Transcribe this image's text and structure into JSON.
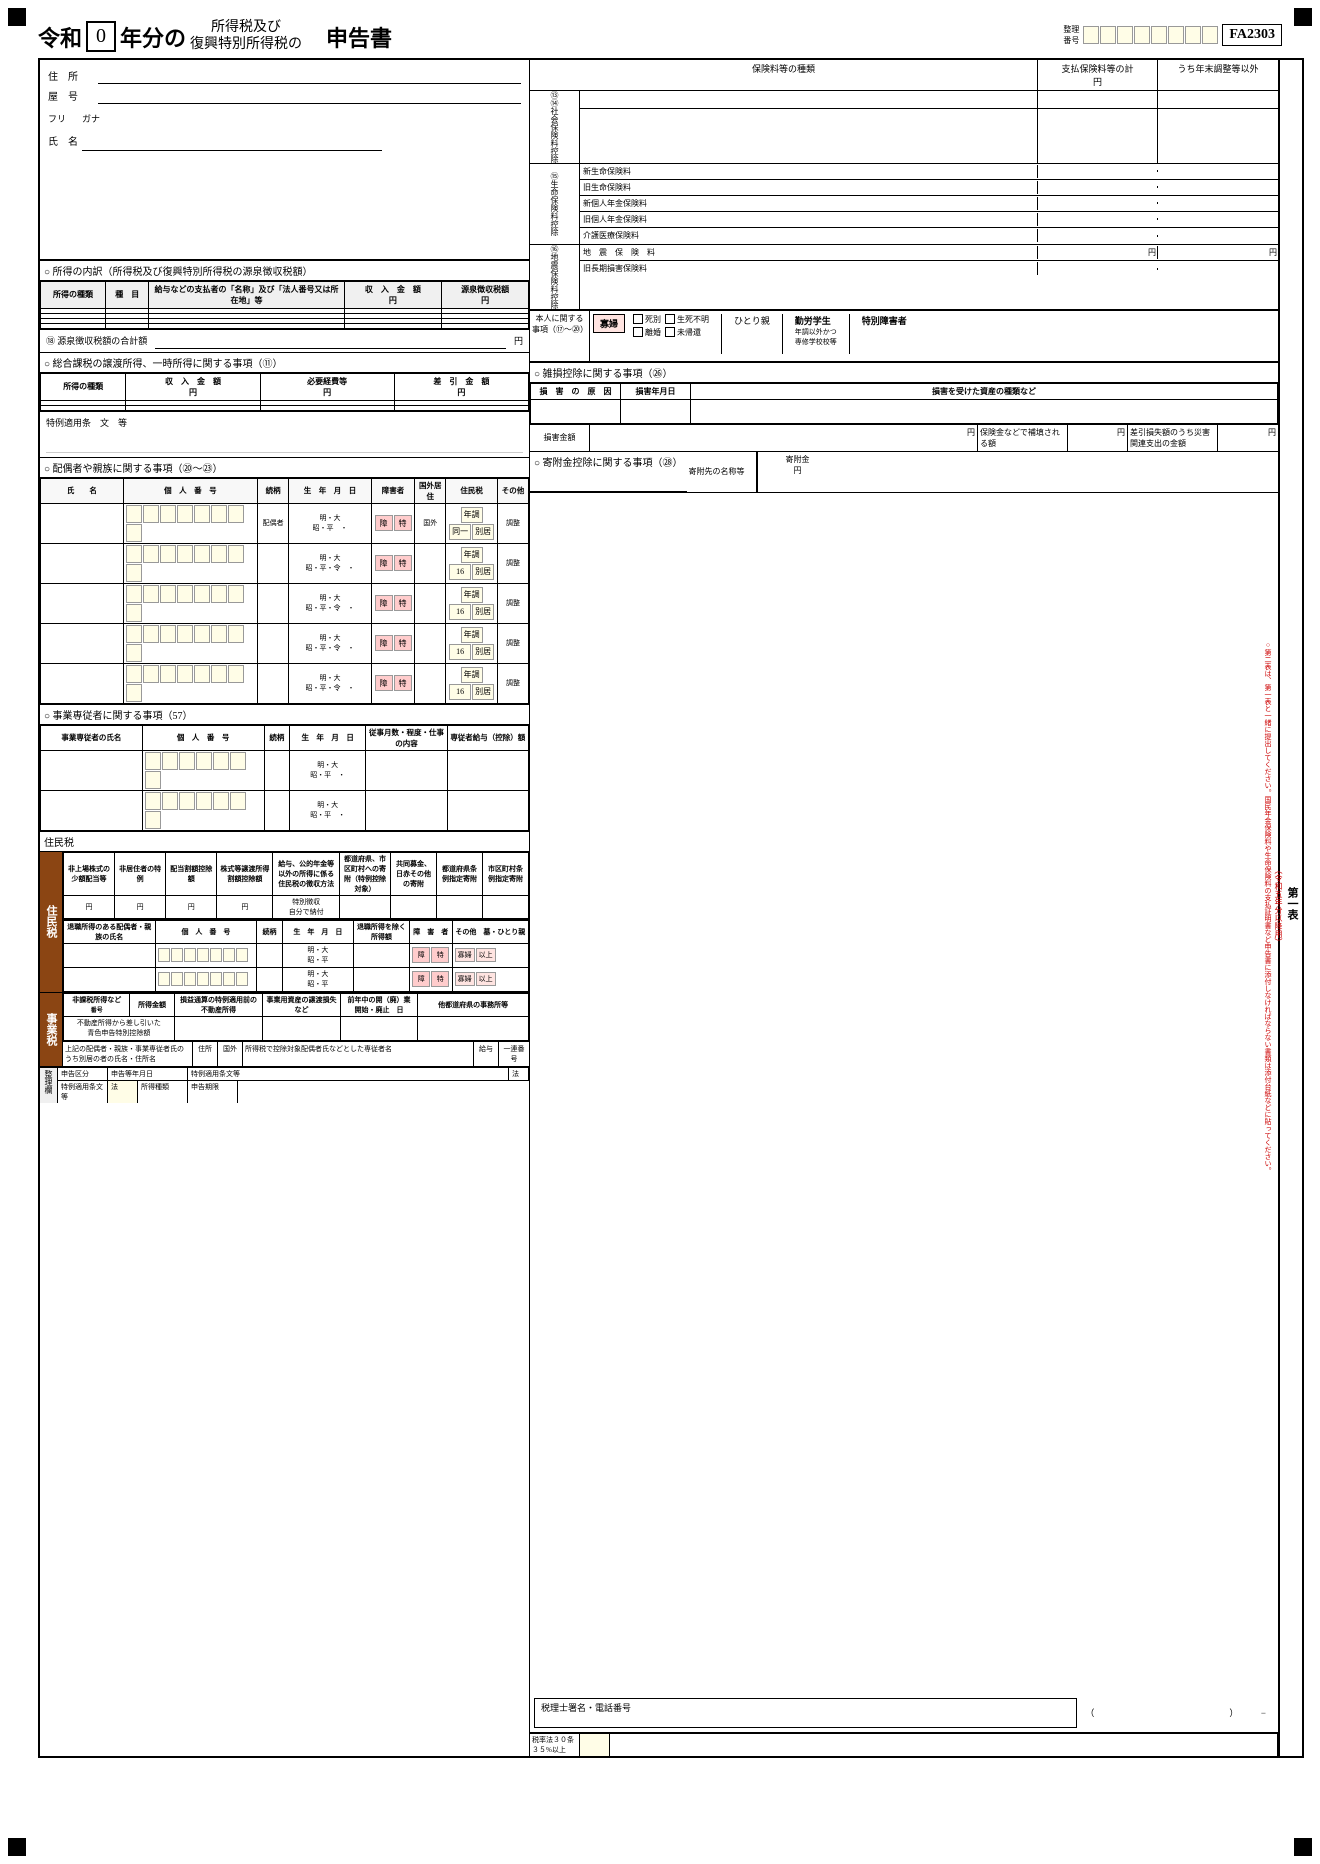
{
  "form": {
    "id": "FA2303",
    "reiwa_year": "0",
    "title_pre": "令和",
    "title_mid": "年分の",
    "title_sub1": "所得税及び",
    "title_sub2": "復興特別所得税の",
    "title_post": "申告書",
    "seiri_label": "整理番号",
    "dai_ichi_hyo": "第一表",
    "side_label_main": "第一表（令和五年分以降用）",
    "side_label_sub": "第二表は、第一表と一緒に提出してください。国民年金保険料や生命保険料の支払証明書など申告書に添付しなければならない書類は添付台紙などに貼ってください。"
  },
  "address": {
    "jyusho_label": "住　所",
    "heya_label": "屋　号",
    "furi_label": "フリ",
    "gana_label": "ガナ",
    "shimei_label": "氏　名"
  },
  "income_section": {
    "title": "○ 所得の内訳（所得税及び復興特別所得税の源泉徴収税額）",
    "col1": "所得の種類",
    "col2": "種　目",
    "col3": "給与などの支払者の「名称」及び「法人番号又は所在地」等",
    "col4": "収　入　金　額",
    "col5": "源泉徴収税額",
    "col4_unit": "円",
    "col5_unit": "円",
    "source_tax_label": "⑱ 源泉徴収税額の合計額",
    "source_tax_unit": "円"
  },
  "transfer_section": {
    "title": "○ 総合課税の譲渡所得、一時所得に関する事項（⑪）",
    "col1": "所得の種類",
    "col2": "収　入　金　額",
    "col3": "必要経費等",
    "col4": "差　引　金　額",
    "col2_unit": "円",
    "col3_unit": "円",
    "col4_unit": "円"
  },
  "special_clause": {
    "label": "特例適用条　文　等"
  },
  "insurance_section": {
    "col1": "保険料等の種類",
    "col2": "支払保険料等の計",
    "col3": "うち年末調整等以外",
    "col2_unit": "円",
    "col3_unit": "円",
    "row1314_label": "⑬⑭社会保険料控除",
    "row15_label": "⑮生命保険料控除",
    "ins_items": [
      {
        "name": "新生命保険料",
        "amount": "",
        "extra": ""
      },
      {
        "name": "旧生命保険料",
        "amount": "",
        "extra": ""
      },
      {
        "name": "新個人年金保険料",
        "amount": "",
        "extra": ""
      },
      {
        "name": "旧個人年金保険料",
        "amount": "",
        "extra": ""
      },
      {
        "name": "介護医療保険料",
        "amount": "",
        "extra": ""
      }
    ],
    "row16_label": "⑯地震保険料控除",
    "jishin_items": [
      {
        "name": "地　震　保　険　料",
        "amount": "",
        "extra": ""
      },
      {
        "name": "旧長期損害保険料",
        "amount": "",
        "extra": ""
      }
    ]
  },
  "personal_section": {
    "title": "本人に関する事項（⑰～⑳）",
    "haisai_label": "寡婦",
    "hitorishin_label": "ひとり親",
    "kinrosei_label": "勤労学生",
    "tokkyo_label": "特別障害者",
    "checks": [
      "死別",
      "生死不明",
      "離婚",
      "未帰還"
    ],
    "kinro_check": "年調以外かつ専修学校校等"
  },
  "disaster_section": {
    "title": "○ 雑損控除に関する事項（㉖）",
    "col1": "損　害　の　原　因",
    "col2": "損害年月日",
    "col3": "損害を受けた資産の種類など",
    "col4": "損害金額",
    "col4_unit": "円",
    "col5": "保険金などで補填される額",
    "col5_unit": "円",
    "col6": "差引損失額のうち災害関連支出の金額",
    "col6_unit": "円"
  },
  "donation_section": {
    "title": "○ 寄附金控除に関する事項（㉘）",
    "name_label": "寄附先の名称等",
    "amount_label": "寄附金",
    "amount_unit": "円"
  },
  "family_section": {
    "title": "○ 配偶者や親族に関する事項（⑳～㉓）",
    "col_name": "氏　　名",
    "col_my_number": "個　人　番　号",
    "col_relation": "続柄",
    "col_birthday": "生　年　月　日",
    "col_disabled": "障害者",
    "col_overseas": "国外居住",
    "col_jitax": "住民税",
    "col_other": "その他",
    "rows": [
      {
        "relation": "配偶者",
        "eras": [
          "明・大",
          "昭・平"
        ],
        "sho": "障",
        "toku": "特",
        "outside": "国外",
        "age": "年調",
        "one": "同一",
        "betsu": "別居",
        "sei": "調整"
      },
      {
        "relation": "",
        "eras": [
          "明・大",
          "昭・平・令"
        ],
        "sho": "障",
        "toku": "特",
        "outside": "",
        "age": "年調",
        "one": "16",
        "betsu": "別居",
        "sei": "調整"
      },
      {
        "relation": "",
        "eras": [
          "明・大",
          "昭・平・令"
        ],
        "sho": "障",
        "toku": "特",
        "outside": "",
        "age": "年調",
        "one": "16",
        "betsu": "別居",
        "sei": "調整"
      },
      {
        "relation": "",
        "eras": [
          "明・大",
          "昭・平・令"
        ],
        "sho": "障",
        "toku": "特",
        "outside": "",
        "age": "年調",
        "one": "16",
        "betsu": "別居",
        "sei": "調整"
      },
      {
        "relation": "",
        "eras": [
          "明・大",
          "昭・平・令"
        ],
        "sho": "障",
        "toku": "特",
        "outside": "",
        "age": "年調",
        "one": "16",
        "betsu": "別居",
        "sei": "調整"
      }
    ]
  },
  "business_worker_section": {
    "title": "○ 事業専従者に関する事項（57）",
    "col_name": "事業専従者の氏名",
    "col_my_number": "個　人　番　号",
    "col_relation": "続柄",
    "col_birthday": "生　年　月　日",
    "col_days": "従事月数・程度・仕事の内容",
    "col_salary": "専従者給与（控除）額",
    "rows": [
      {
        "eras": [
          "明・大",
          "昭・平"
        ]
      },
      {
        "eras": [
          "明・大",
          "昭・平"
        ]
      }
    ]
  },
  "resident_tax_section": {
    "label": "住民税",
    "cols": [
      "非上場株式の少額配当等",
      "非居住者の特例",
      "配当割額控除額",
      "株式等譲渡所得割額控除額",
      "給与、公的年金等以外の所得に係る住民税の徴収方法",
      "都道府県、市区町村への寄附（特例控除対象）",
      "共同募金、日赤その他の寄附",
      "都道府県条例指定寄附",
      "市区町村条例指定寄附"
    ],
    "units": [
      "円",
      "円",
      "円",
      "円",
      "特別徴収 / 自分で納付",
      "",
      ""
    ],
    "retirement_row": {
      "label1": "退職所得のある配偶者・親族の氏名",
      "col_my_number": "個　人　番　号",
      "col_relation": "続柄",
      "col_birthday": "生　年　月　日",
      "col_income": "退職所得を除く所得額",
      "col_disabled": "障害者",
      "col_other": "その他 墓・ひとり親",
      "rows": [
        {
          "eras": [
            "明・大",
            "昭・平"
          ]
        },
        {
          "eras": [
            "明・大",
            "昭・平"
          ]
        }
      ]
    }
  },
  "business_tax_section": {
    "label": "事業税",
    "col1": "非課税所得など",
    "col1_sub": "番号",
    "col2": "所得金額",
    "col3": "損益通算の特例適用前の不動産所得",
    "col4": "事業用資産の譲渡損失など",
    "col5": "前年中の開（廃）業",
    "col5_sub": "開始・廃止",
    "col5_date": "日",
    "col6": "他都道府県の事務所等",
    "blue_label": "不動産所得から差し引いた青色申告特別控除額",
    "family_address_label": "上記の配偶者・親族・事業専従者氏のうち別居の者の氏名・住所名",
    "family_address_sub": "住所",
    "overseas_label": "国外",
    "dedicated_label": "所得税で控除対象配偶者氏などとした専従者名",
    "salary_label": "給与",
    "ichiren_label": "一連番号"
  },
  "seiri_section": {
    "label": "整理欄",
    "shinsei_label": "申告区分",
    "shinkoku_date": "申告等年月日",
    "tokubetsu_label": "特例適用条文等",
    "ho_label": "法",
    "shotoku_label": "所得種類",
    "shinsei_kigen": "申告期限",
    "zeiritsu_label": "税率法３０条３５%以上",
    "tax_accountant_label": "税理士署名・電話番号"
  }
}
